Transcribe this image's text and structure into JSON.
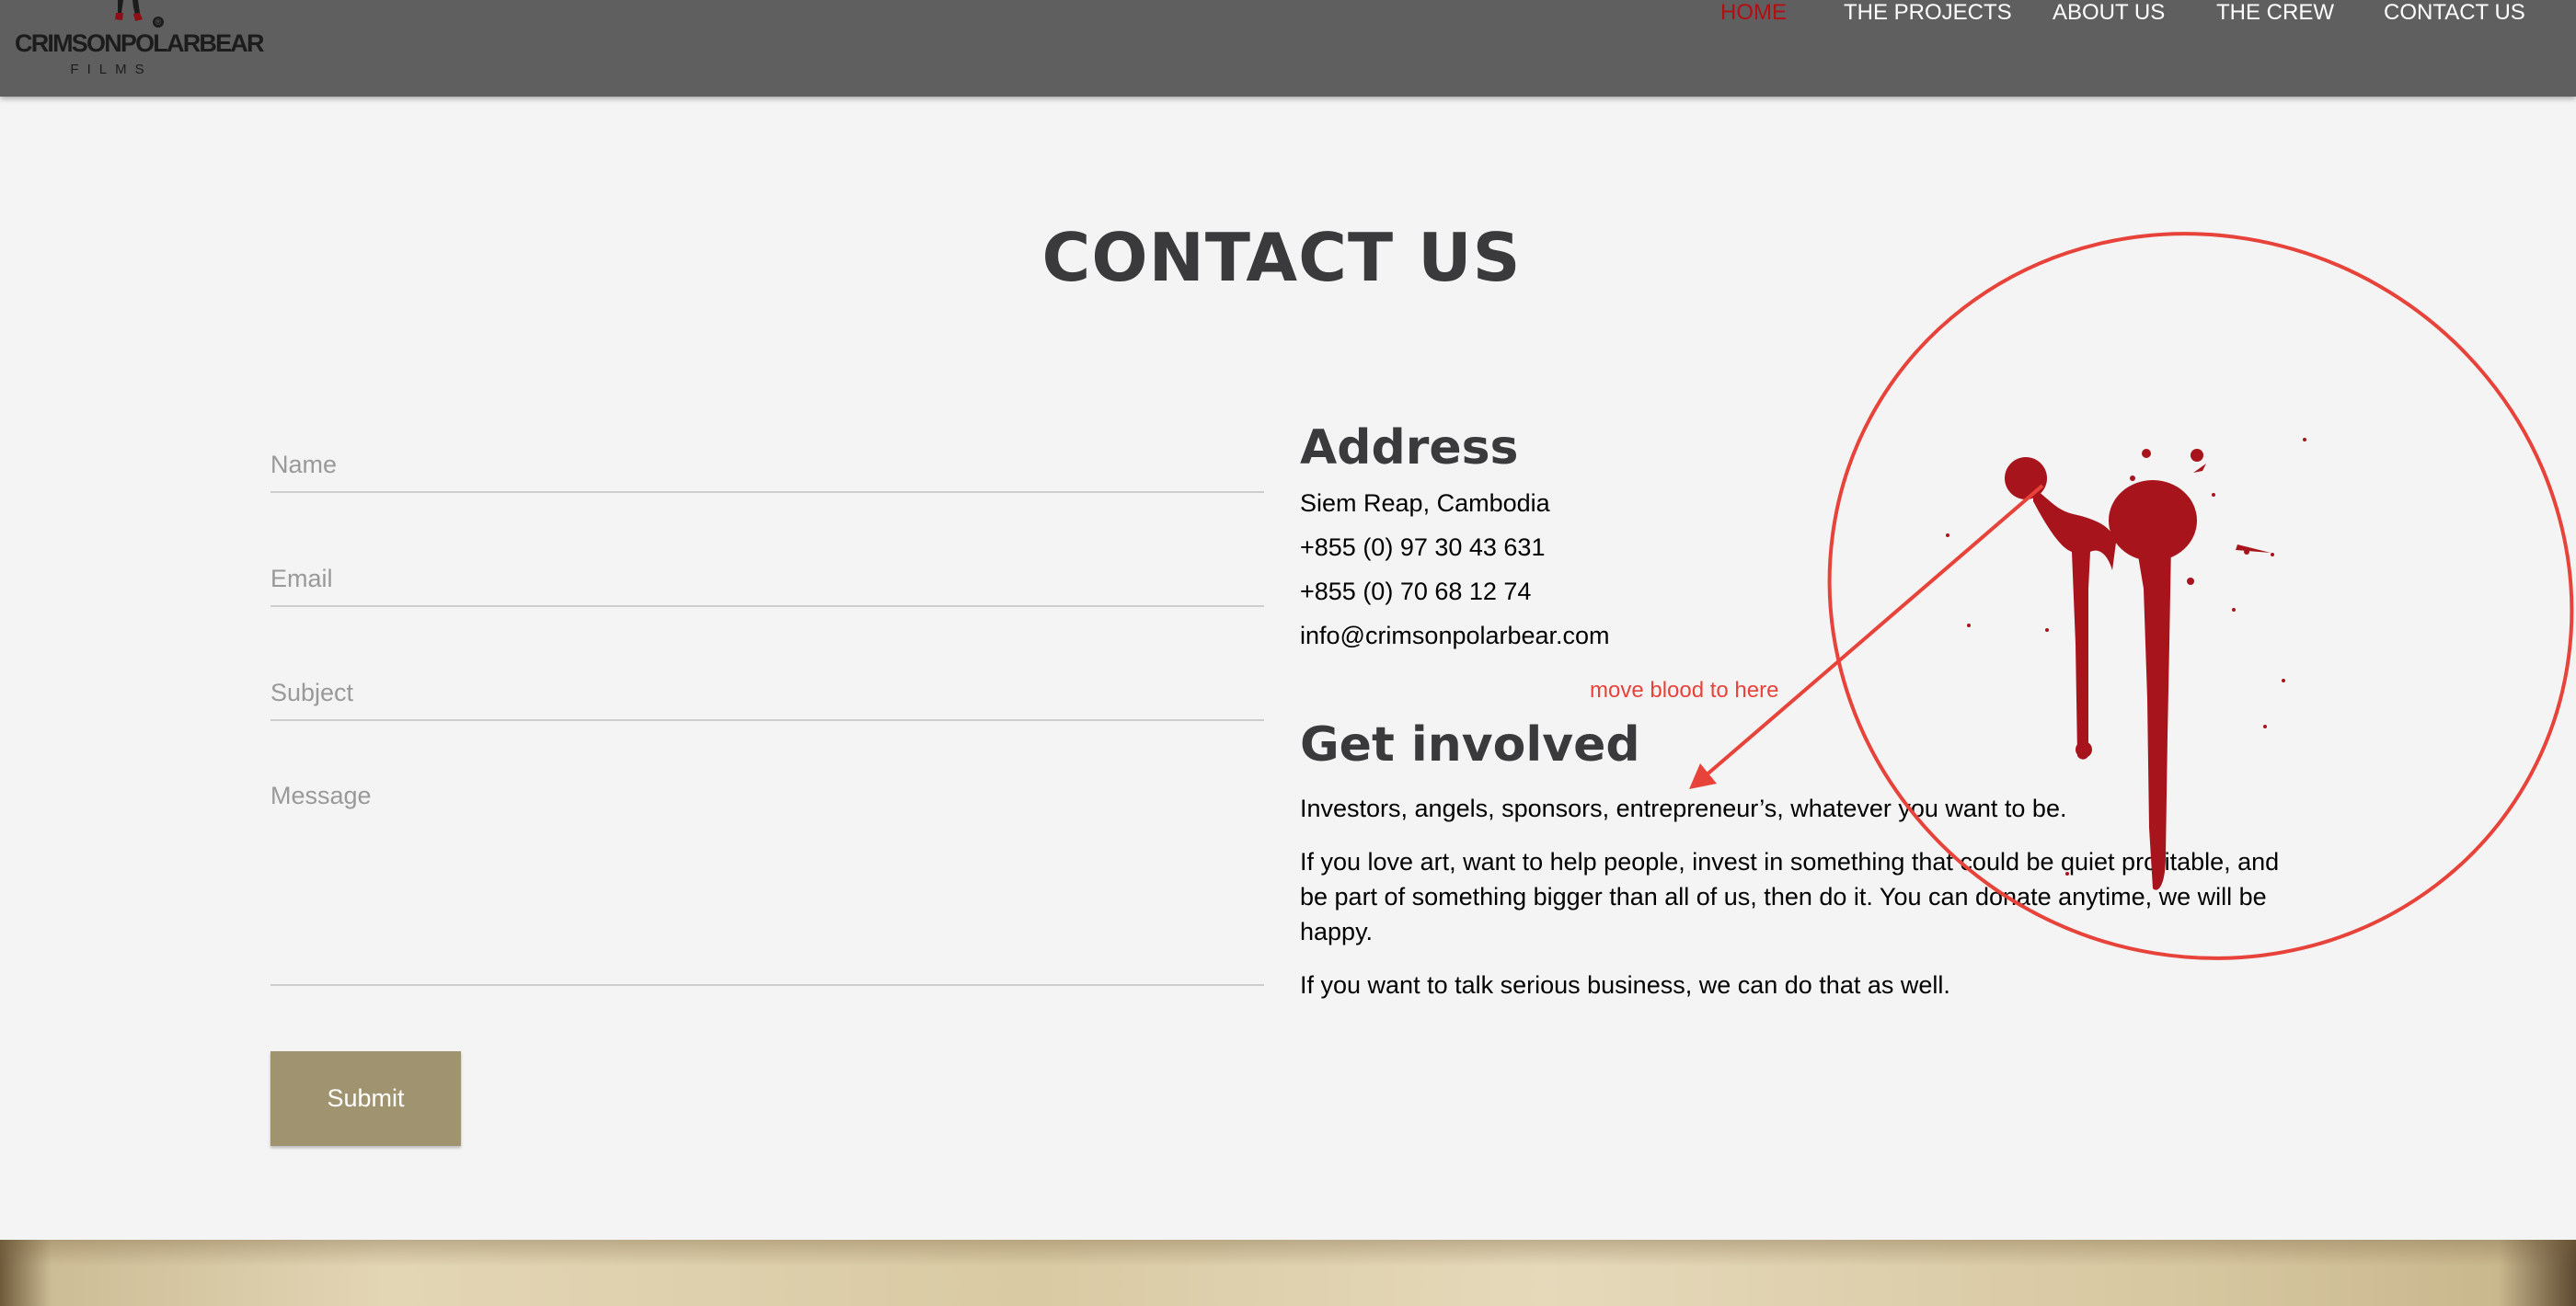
{
  "header": {
    "logo": {
      "wordmark": "CRIMSONPOLARBEAR",
      "subtitle": "FILMS",
      "registered": "®"
    },
    "nav": [
      {
        "label": "HOME",
        "active": true
      },
      {
        "label": "THE PROJECTS",
        "active": false
      },
      {
        "label": "ABOUT US",
        "active": false
      },
      {
        "label": "THE CREW",
        "active": false
      },
      {
        "label": "CONTACT US",
        "active": false
      }
    ]
  },
  "main": {
    "title": "CONTACT US",
    "form": {
      "name_placeholder": "Name",
      "email_placeholder": "Email",
      "subject_placeholder": "Subject",
      "message_placeholder": "Message",
      "submit_label": "Submit"
    },
    "address": {
      "heading": "Address",
      "city": "Siem Reap, Cambodia",
      "phone1": "+855 (0) 97 30 43 631",
      "phone2": "+855 (0) 70 68 12 74",
      "email": "info@crimsonpolarbear.com"
    },
    "involved": {
      "heading": "Get involved",
      "paragraphs": [
        "Investors, angels, sponsors, entrepreneur’s, whatever you want to be.",
        "If you love art, want to help people, invest in something that could be quiet profitable, and be part of something bigger than all of us, then do it. You can donate anytime, we will be happy.",
        "If you want to talk serious business, we can do that as well."
      ]
    }
  },
  "annotation": {
    "note": "move blood to here",
    "color": "#e8433a"
  },
  "colors": {
    "header_bg": "#5f5f5f",
    "nav_active": "#b40d14",
    "heading": "#3a3a3c",
    "submit_bg": "#a0936f",
    "page_bg": "#f4f4f4",
    "blood": "#a8141c"
  },
  "icons": {
    "logo_figure": "polar-bear-figure-icon",
    "blood_splatter": "blood-splatter-image"
  }
}
